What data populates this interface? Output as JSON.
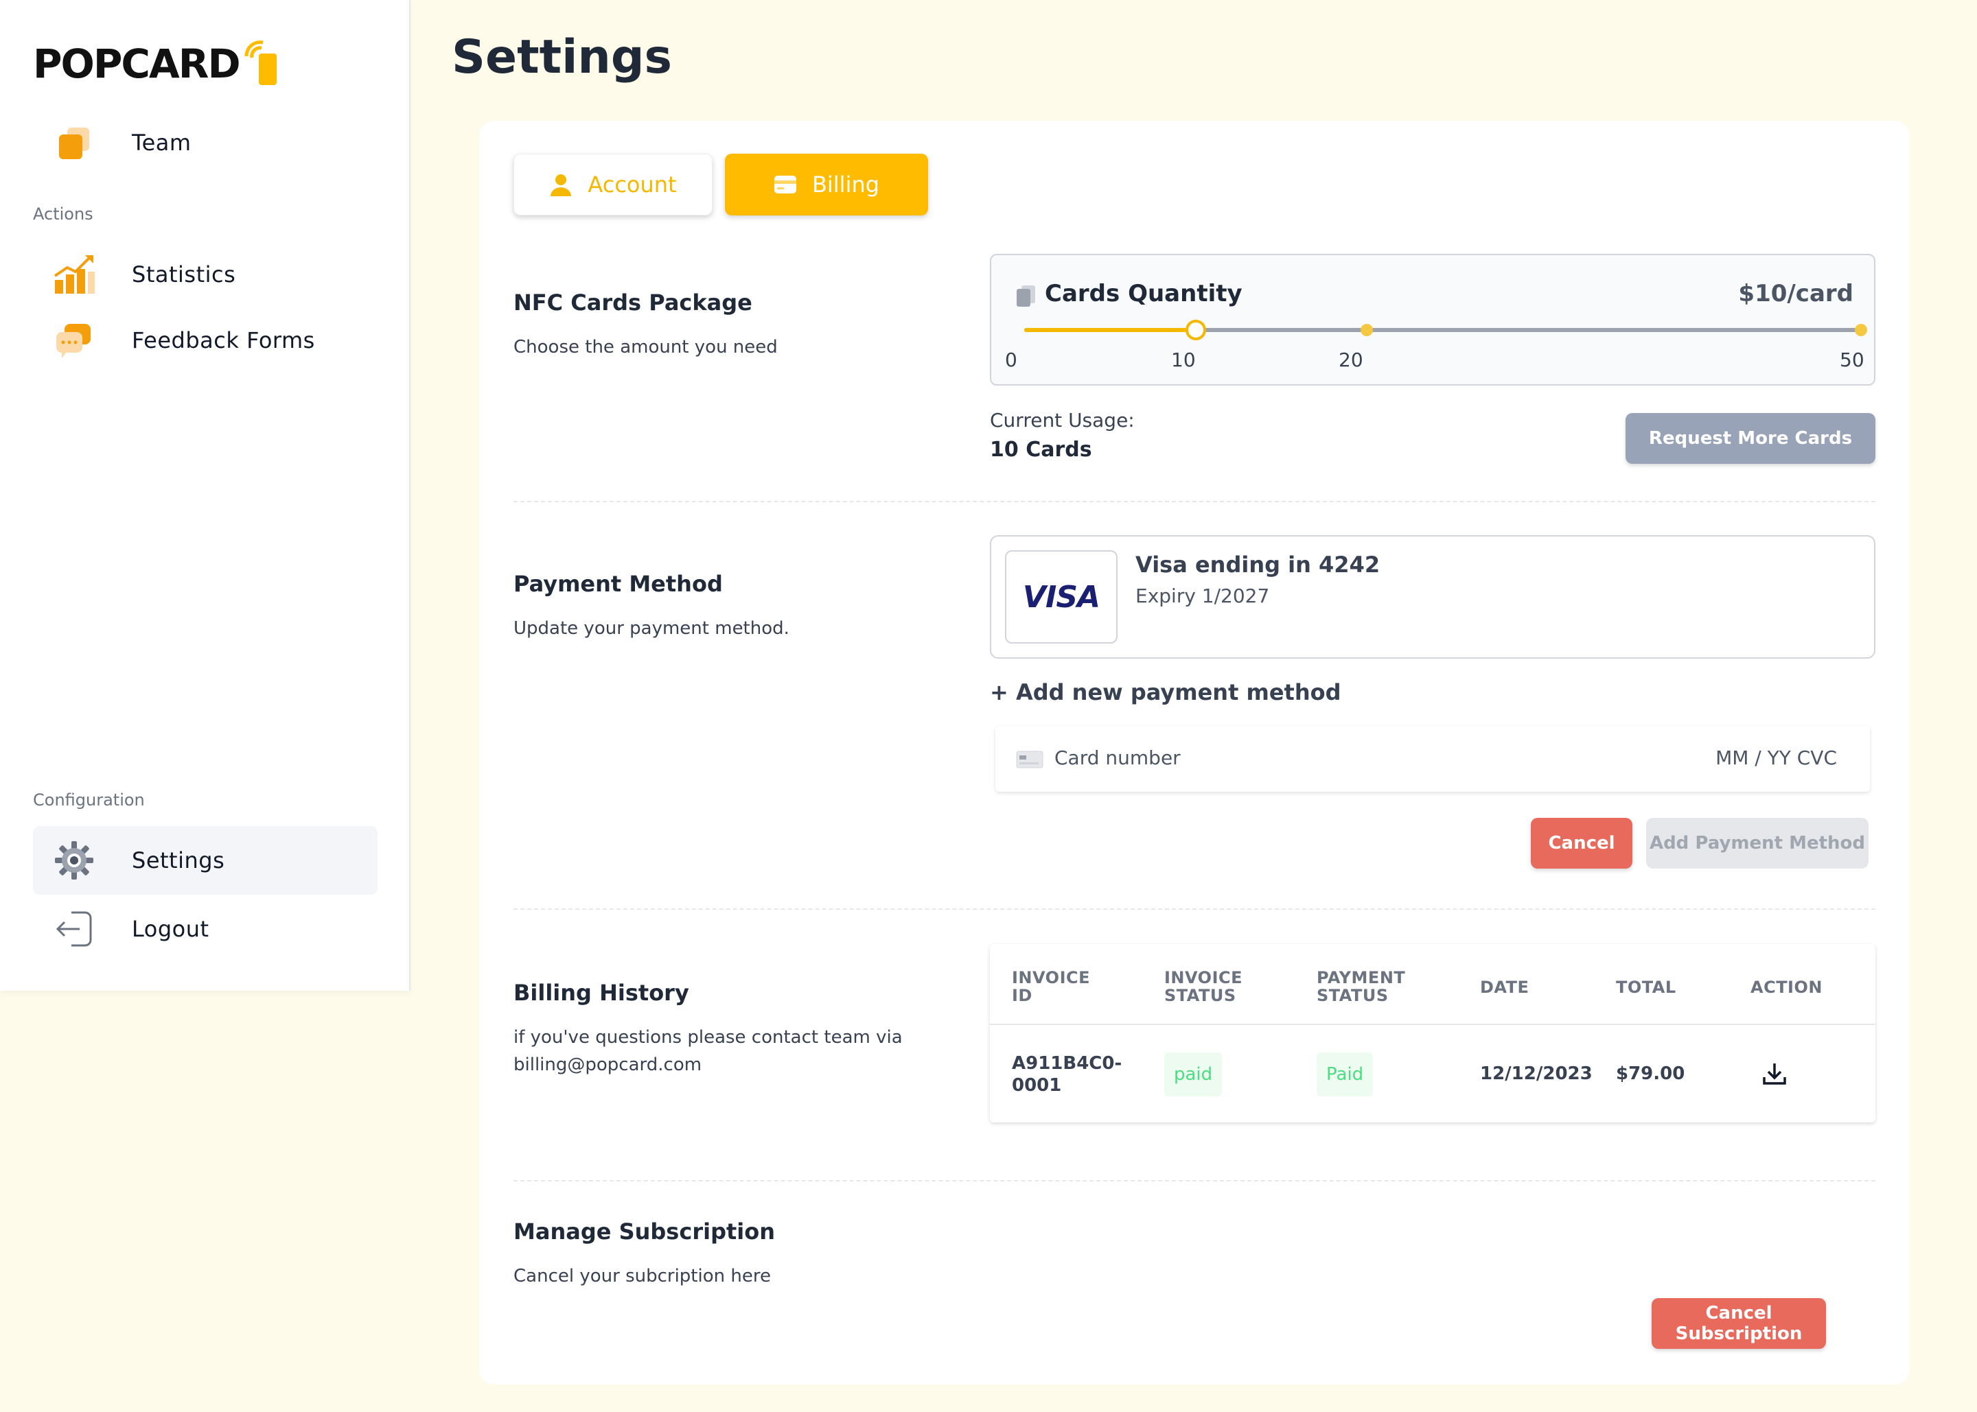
{
  "app": {
    "logo_text": "POPCARD"
  },
  "sidebar": {
    "team_label": "Team",
    "actions_label": "Actions",
    "statistics_label": "Statistics",
    "feedback_label": "Feedback Forms",
    "configuration_label": "Configuration",
    "settings_label": "Settings",
    "logout_label": "Logout"
  },
  "page": {
    "title": "Settings"
  },
  "tabs": {
    "account": "Account",
    "billing": "Billing",
    "active": "billing"
  },
  "nfc": {
    "title": "NFC Cards Package",
    "subtitle": "Choose the amount you need",
    "qty_title": "Cards Quantity",
    "price": "$10/card",
    "slider_value": 10,
    "slider_min": 0,
    "slider_max": 50,
    "ticks": [
      "0",
      "10",
      "20",
      "50"
    ],
    "usage_label": "Current Usage:",
    "usage_value": "10 Cards",
    "request_button": "Request More Cards"
  },
  "payment": {
    "title": "Payment Method",
    "subtitle": "Update your payment method.",
    "card_brand": "VISA",
    "card_title": "Visa ending in 4242",
    "card_expiry": "Expiry 1/2027",
    "add_link": "+ Add new payment method",
    "card_number_placeholder": "Card number",
    "card_right_placeholder": "MM / YY  CVC",
    "cancel_button": "Cancel",
    "add_button": "Add Payment Method"
  },
  "billing": {
    "title": "Billing History",
    "subtitle": "if you've questions please contact team via billing@popcard.com",
    "headers": {
      "invoice_id_1": "INVOICE",
      "invoice_id_2": "ID",
      "invoice_status_1": "INVOICE",
      "invoice_status_2": "STATUS",
      "payment_status_1": "PAYMENT",
      "payment_status_2": "STATUS",
      "date": "DATE",
      "total": "TOTAL",
      "action": "ACTION"
    },
    "rows": [
      {
        "id_1": "A911B4C0-",
        "id_2": "0001",
        "invoice_status": "paid",
        "payment_status": "Paid",
        "date": "12/12/2023",
        "total": "$79.00"
      }
    ]
  },
  "subscription": {
    "title": "Manage Subscription",
    "subtitle": "Cancel your subcription here",
    "cancel_button": "Cancel Subscription"
  },
  "colors": {
    "accent": "#ffbb00",
    "danger": "#e86a5c",
    "muted_button": "#98a3b8"
  }
}
